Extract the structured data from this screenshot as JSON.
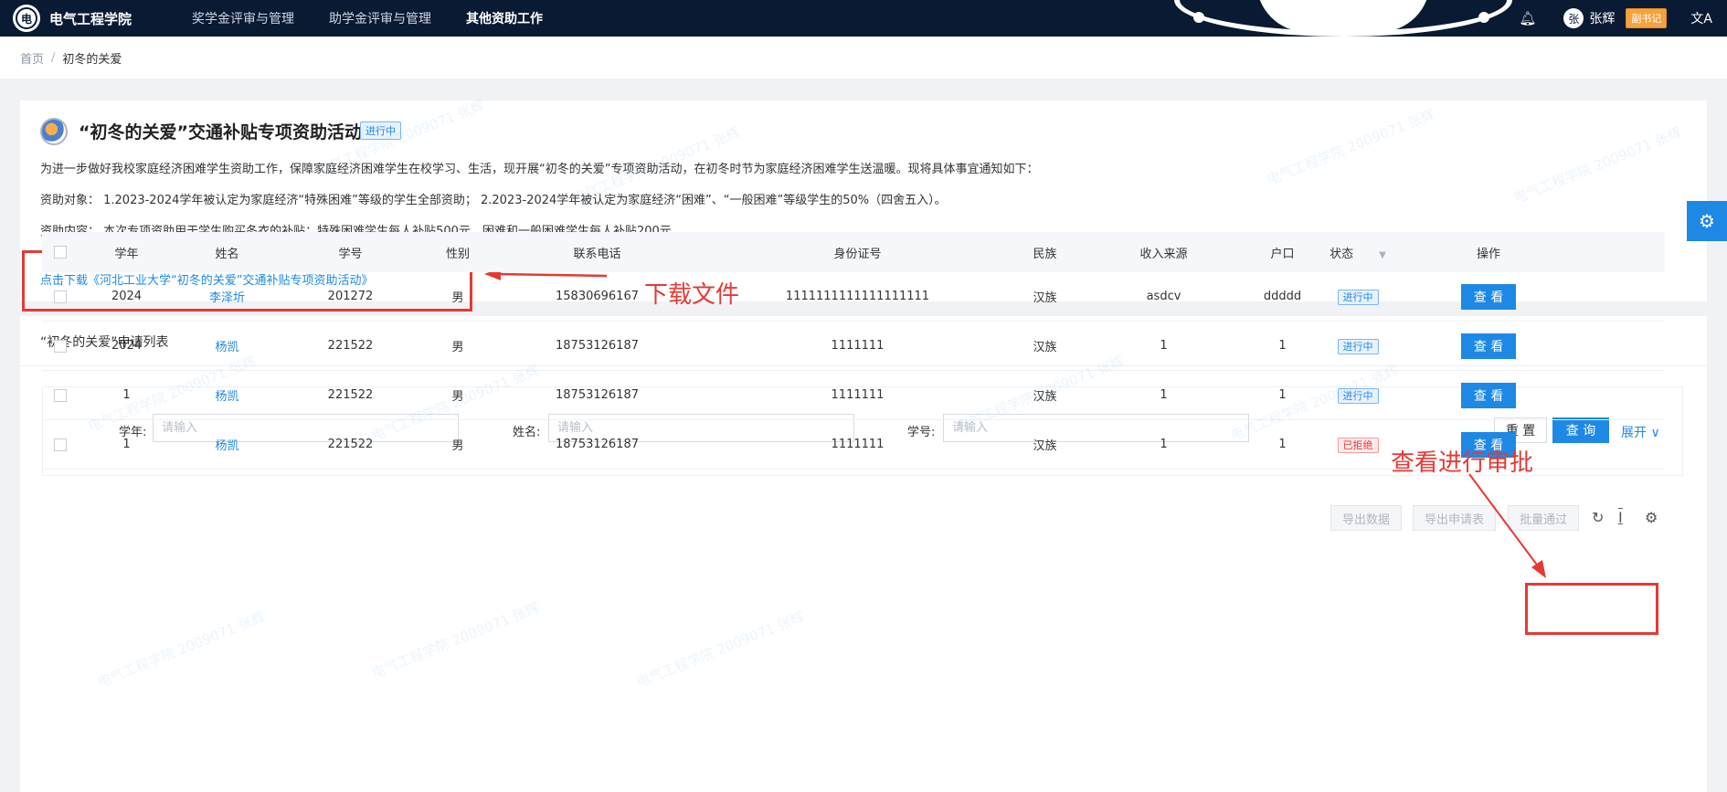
{
  "nav": {
    "brand": "电气工程学院",
    "logo_text": "电",
    "items": [
      {
        "label": "奖学金评审与管理",
        "active": false
      },
      {
        "label": "助学金评审与管理",
        "active": false
      },
      {
        "label": "其他资助工作",
        "active": true
      }
    ],
    "bell_icon": "bell-icon",
    "avatar_text": "张",
    "username": "张辉",
    "role": "副书记",
    "lang_icon": "文A"
  },
  "breadcrumb": {
    "home": "首页",
    "separator": "/",
    "current": "初冬的关爱"
  },
  "activity": {
    "title": "“初冬的关爱”交通补贴专项资助活动",
    "status": "进行中",
    "intro": "为进一步做好我校家庭经济困难学生资助工作，保障家庭经济困难学生在校学习、生活，现开展“初冬的关爱”专项资助活动，在初冬时节为家庭经济困难学生送温暖。现将具体事宜通知如下：",
    "target": "资助对象：   1.2023-2024学年被认定为家庭经济“特殊困难”等级的学生全部资助；   2.2023-2024学年被认定为家庭经济“困难”、“一般困难”等级学生的50%（四舍五入）。",
    "content": "资助内容：   本次专项资助用于学生购买冬衣的补贴：特殊困难学生每人补贴500元，困难和一般困难学生每人补贴200元。",
    "download_link": "点击下载《河北工业大学“初冬的关爱”交通补贴专项资助活动》"
  },
  "annotations": {
    "download": "下载文件",
    "review": "查看进行审批",
    "color": "#e53935"
  },
  "list": {
    "title": "“初冬的关爱”申请列表",
    "search": {
      "year_label": "学年:",
      "name_label": "姓名:",
      "id_label": "学号:",
      "placeholder": "请输入",
      "reset": "重 置",
      "query": "查 询",
      "expand": "展开 ∨"
    },
    "toolbar": {
      "export_data": "导出数据",
      "export_form": "导出申请表",
      "batch_pass": "批量通过",
      "refresh_icon": "↻",
      "density_icon": "I",
      "settings_icon": "⚙"
    },
    "columns": [
      "学年",
      "姓名",
      "学号",
      "性别",
      "联系电话",
      "身份证号",
      "民族",
      "收入来源",
      "户口",
      "状态",
      "操作"
    ],
    "rows": [
      {
        "year": "2024",
        "name": "李泽圻",
        "sid": "201272",
        "gender": "男",
        "phone": "15830696167",
        "idcard": "1111111111111111111",
        "ethnic": "汉族",
        "income": "asdcv",
        "hukou": "ddddd",
        "status": "进行中",
        "status_type": "running",
        "action": "查 看"
      },
      {
        "year": "2024",
        "name": "杨凯",
        "sid": "221522",
        "gender": "男",
        "phone": "18753126187",
        "idcard": "1111111",
        "ethnic": "汉族",
        "income": "1",
        "hukou": "1",
        "status": "进行中",
        "status_type": "running",
        "action": "查 看"
      },
      {
        "year": "1",
        "name": "杨凯",
        "sid": "221522",
        "gender": "男",
        "phone": "18753126187",
        "idcard": "1111111",
        "ethnic": "汉族",
        "income": "1",
        "hukou": "1",
        "status": "进行中",
        "status_type": "running",
        "action": "查 看"
      },
      {
        "year": "1",
        "name": "杨凯",
        "sid": "221522",
        "gender": "男",
        "phone": "18753126187",
        "idcard": "1111111",
        "ethnic": "汉族",
        "income": "1",
        "hukou": "1",
        "status": "已拒绝",
        "status_type": "rejected",
        "action": "查 看"
      }
    ]
  },
  "watermark": "电气工程学院 2009071 张辉",
  "settings_float_icon": "⚙",
  "colors": {
    "primary": "#1e88e5",
    "nav_bg": "#0a1a33",
    "danger": "#e53935",
    "badge": "#f6a23c"
  }
}
